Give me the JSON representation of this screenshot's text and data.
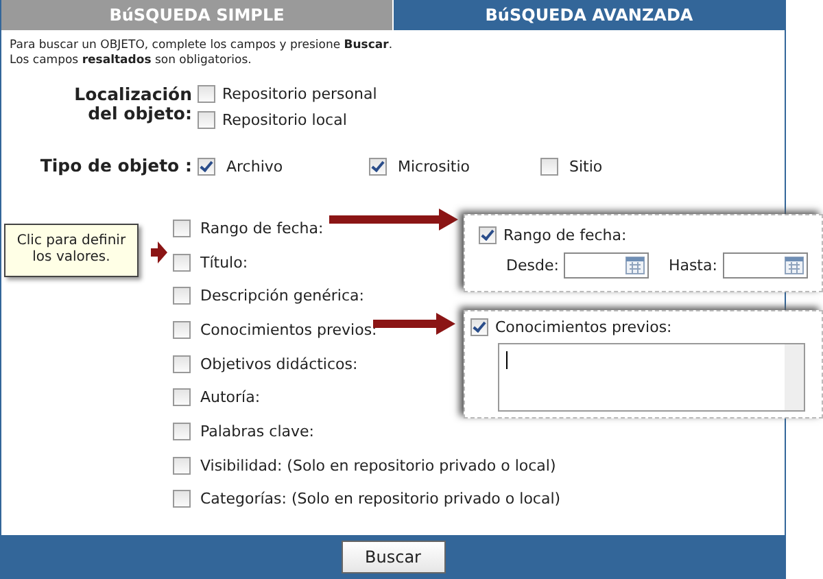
{
  "tabs": [
    {
      "label": "BúSQUEDA SIMPLE",
      "selected": false
    },
    {
      "label": "BúSQUEDA AVANZADA",
      "selected": true
    }
  ],
  "instructions": [
    "Para buscar un OBJETO, complete los campos y presione **Buscar**.",
    "Los campos **resaltados** son obligatorios."
  ],
  "location": {
    "label": "Localización del objeto:",
    "options": [
      {
        "label": "Repositorio personal",
        "checked": false
      },
      {
        "label": "Repositorio local",
        "checked": false
      }
    ]
  },
  "object_type": {
    "label": "Tipo de objeto :",
    "options": [
      {
        "label": "Archivo",
        "checked": true
      },
      {
        "label": "Micrositio",
        "checked": true
      },
      {
        "label": "Sitio",
        "checked": false
      }
    ]
  },
  "criteria": [
    {
      "label": "Rango de fecha:",
      "checked": false
    },
    {
      "label": "Título:",
      "checked": false
    },
    {
      "label": "Descripción genérica:",
      "checked": false
    },
    {
      "label": "Conocimientos previos:",
      "checked": false
    },
    {
      "label": "Objetivos didácticos:",
      "checked": false
    },
    {
      "label": "Autoría:",
      "checked": false
    },
    {
      "label": "Palabras clave:",
      "checked": false
    },
    {
      "label": "Visibilidad: (Solo en repositorio privado o local)",
      "checked": false
    },
    {
      "label": "Categorías: (Solo en repositorio privado o local)",
      "checked": false
    }
  ],
  "tooltip": {
    "text": "Clic para definir los valores."
  },
  "callouts": [
    {
      "kind": "date",
      "label": "Rango de fecha:",
      "checked": true,
      "from_label": "Desde:",
      "to_label": "Hasta:"
    },
    {
      "kind": "text",
      "label": "Conocimientos previos:",
      "checked": true
    }
  ],
  "button": "Buscar"
}
